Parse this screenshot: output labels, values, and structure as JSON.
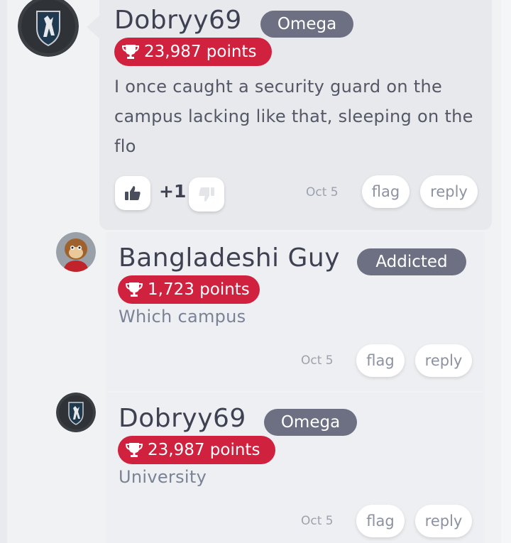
{
  "comments": [
    {
      "username": "Dobryy69",
      "rank": "Omega",
      "points": "23,987 points",
      "message": "I once caught a security guard on the campus lacking like that, sleeping on the flo",
      "score": "+1",
      "date": "Oct 5",
      "flag_label": "flag",
      "reply_label": "reply"
    },
    {
      "username": "Bangladeshi Guy",
      "rank": "Addicted",
      "points": "1,723 points",
      "message": "Which campus",
      "date": "Oct 5",
      "flag_label": "flag",
      "reply_label": "reply"
    },
    {
      "username": "Dobryy69",
      "rank": "Omega",
      "points": "23,987 points",
      "message": "University",
      "date": "Oct 5",
      "flag_label": "flag",
      "reply_label": "reply"
    }
  ],
  "colors": {
    "points_badge": "#d0213f",
    "rank_badge": "#6c7082",
    "bubble": "#e8e9ed",
    "reply_panel": "#eeeff2"
  },
  "icons": {
    "trophy": "trophy-icon",
    "upvote": "thumbs-up-icon",
    "downvote": "thumbs-down-icon"
  }
}
